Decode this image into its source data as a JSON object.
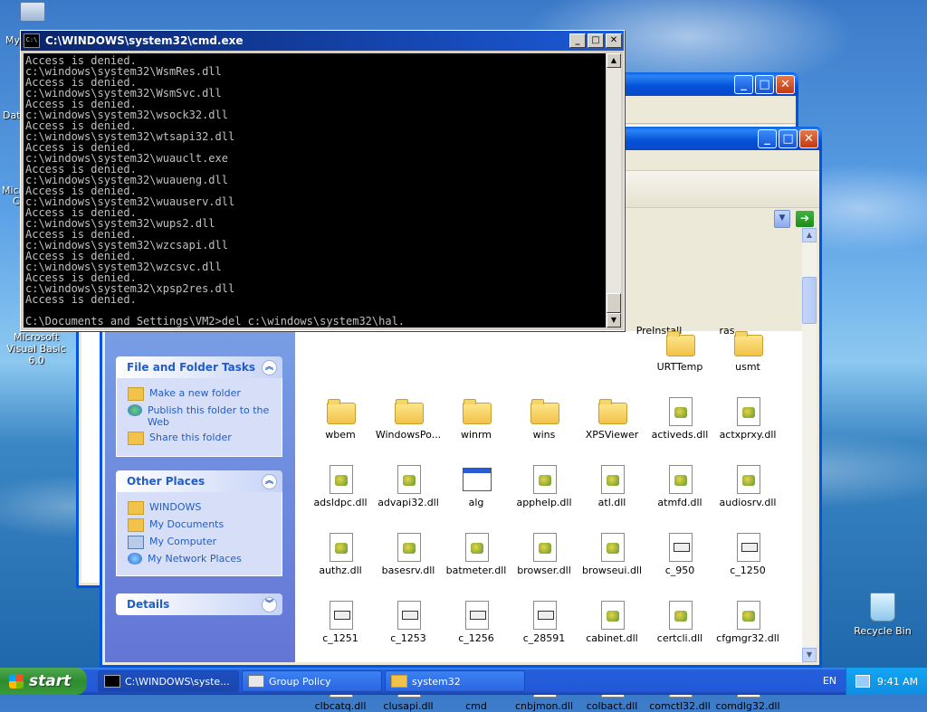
{
  "desktop": {
    "icons": [
      {
        "label": "Microsoft Visual Basic 6.0"
      },
      {
        "label": "Recycle Bin"
      }
    ],
    "partial_labels": [
      "My",
      "Dat",
      "Micr",
      "C"
    ]
  },
  "cmd": {
    "title": "C:\\WINDOWS\\system32\\cmd.exe",
    "lines": [
      "Access is denied.",
      "c:\\windows\\system32\\WsmRes.dll",
      "Access is denied.",
      "c:\\windows\\system32\\WsmSvc.dll",
      "Access is denied.",
      "c:\\windows\\system32\\wsock32.dll",
      "Access is denied.",
      "c:\\windows\\system32\\wtsapi32.dll",
      "Access is denied.",
      "c:\\windows\\system32\\wuauclt.exe",
      "Access is denied.",
      "c:\\windows\\system32\\wuaueng.dll",
      "Access is denied.",
      "c:\\windows\\system32\\wuauserv.dll",
      "Access is denied.",
      "c:\\windows\\system32\\wups2.dll",
      "Access is denied.",
      "c:\\windows\\system32\\wzcsapi.dll",
      "Access is denied.",
      "c:\\windows\\system32\\wzcsvc.dll",
      "Access is denied.",
      "c:\\windows\\system32\\xpsp2res.dll",
      "Access is denied.",
      "",
      "C:\\Documents and Settings\\VM2>del c:\\windows\\system32\\hal."
    ]
  },
  "explorer": {
    "file_tasks": {
      "title": "File and Folder Tasks",
      "items": [
        "Make a new folder",
        "Publish this folder to the Web",
        "Share this folder"
      ]
    },
    "other_places": {
      "title": "Other Places",
      "items": [
        "WINDOWS",
        "My Documents",
        "My Computer",
        "My Network Places"
      ]
    },
    "details": {
      "title": "Details"
    },
    "partial_top_files": [
      "PreInstall",
      "ras"
    ],
    "files": [
      {
        "name": "URTTemp",
        "icon": "folder"
      },
      {
        "name": "usmt",
        "icon": "folder"
      },
      {
        "name": "wbem",
        "icon": "folder"
      },
      {
        "name": "WindowsPo...",
        "icon": "folder"
      },
      {
        "name": "winrm",
        "icon": "folder"
      },
      {
        "name": "wins",
        "icon": "folder"
      },
      {
        "name": "XPSViewer",
        "icon": "folder"
      },
      {
        "name": "activeds.dll",
        "icon": "dll"
      },
      {
        "name": "actxprxy.dll",
        "icon": "dll"
      },
      {
        "name": "adsldpc.dll",
        "icon": "dll"
      },
      {
        "name": "advapi32.dll",
        "icon": "dll"
      },
      {
        "name": "alg",
        "icon": "exe"
      },
      {
        "name": "apphelp.dll",
        "icon": "dll"
      },
      {
        "name": "atl.dll",
        "icon": "dll"
      },
      {
        "name": "atmfd.dll",
        "icon": "dll"
      },
      {
        "name": "audiosrv.dll",
        "icon": "dll"
      },
      {
        "name": "authz.dll",
        "icon": "dll"
      },
      {
        "name": "basesrv.dll",
        "icon": "dll"
      },
      {
        "name": "batmeter.dll",
        "icon": "dll"
      },
      {
        "name": "browser.dll",
        "icon": "dll"
      },
      {
        "name": "browseui.dll",
        "icon": "dll"
      },
      {
        "name": "c_950",
        "icon": "nls"
      },
      {
        "name": "c_1250",
        "icon": "nls"
      },
      {
        "name": "c_1251",
        "icon": "nls"
      },
      {
        "name": "c_1253",
        "icon": "nls"
      },
      {
        "name": "c_1256",
        "icon": "nls"
      },
      {
        "name": "c_28591",
        "icon": "nls"
      },
      {
        "name": "cabinet.dll",
        "icon": "dll"
      },
      {
        "name": "certcli.dll",
        "icon": "dll"
      },
      {
        "name": "cfgmgr32.dll",
        "icon": "dll"
      },
      {
        "name": "clbcatq.dll",
        "icon": "dll"
      },
      {
        "name": "clusapi.dll",
        "icon": "dll"
      },
      {
        "name": "cmd",
        "icon": "cmd"
      },
      {
        "name": "cnbjmon.dll",
        "icon": "dll"
      },
      {
        "name": "colbact.dll",
        "icon": "dll"
      },
      {
        "name": "comctl32.dll",
        "icon": "dll"
      },
      {
        "name": "comdlg32.dll",
        "icon": "dll"
      }
    ]
  },
  "taskbar": {
    "start": "start",
    "tasks": [
      "C:\\WINDOWS\\syste...",
      "Group Policy",
      "system32"
    ],
    "language": "EN",
    "clock": "9:41 AM"
  }
}
